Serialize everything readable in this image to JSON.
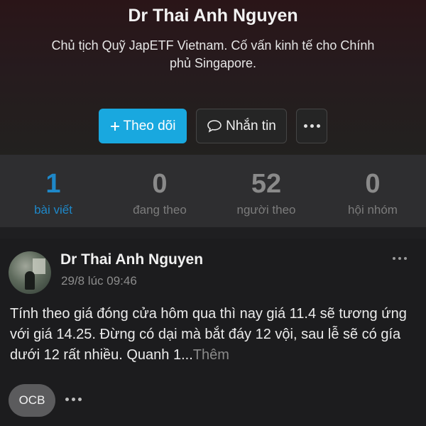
{
  "profile": {
    "name": "Dr Thai Anh Nguyen",
    "bio": "Chủ tịch Quỹ JapETF Vietnam. Cố vấn kinh tế cho Chính phủ Singapore."
  },
  "actions": {
    "follow_label": "Theo dõi",
    "follow_icon": "plus-icon",
    "message_label": "Nhắn tin",
    "message_icon": "chat-bubble-icon",
    "more_icon": "more-horizontal-icon"
  },
  "stats": [
    {
      "value": "1",
      "label": "bài viết",
      "active": true
    },
    {
      "value": "0",
      "label": "đang theo",
      "active": false
    },
    {
      "value": "52",
      "label": "người theo",
      "active": false
    },
    {
      "value": "0",
      "label": "hội nhóm",
      "active": false
    }
  ],
  "post": {
    "author": "Dr Thai Anh Nguyen",
    "time": "29/8 lúc 09:46",
    "text": "Tính theo giá đóng cửa hôm qua thì nay giá 11.4 sẽ tương ứng với giá 14.25. Đừng có dại mà bắt đáy 12 vội, sau lễ sẽ có gía dưới 12 rất nhiều. Quanh 1...",
    "more_label": "Thêm",
    "tag": "OCB"
  },
  "colors": {
    "accent": "#19a8df",
    "active_stat": "#1e88c9",
    "background": "#1f1f21"
  }
}
